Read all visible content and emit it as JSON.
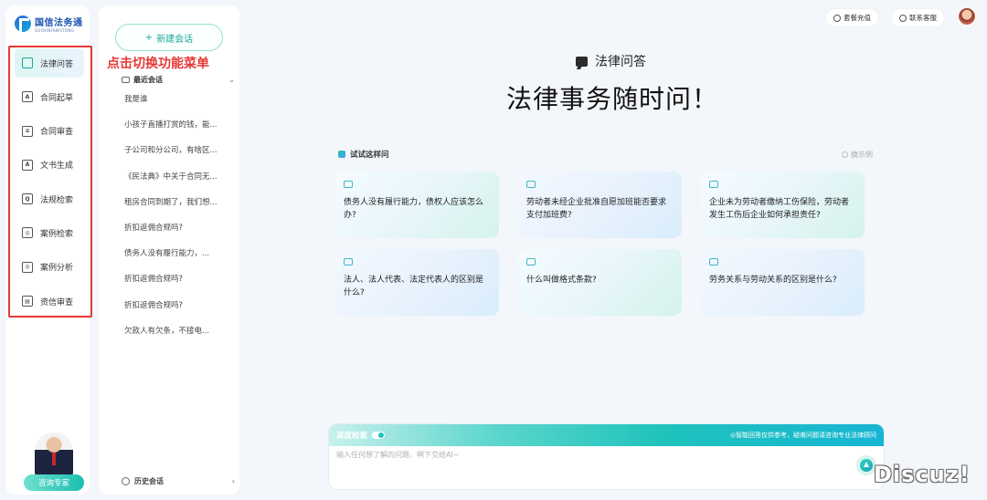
{
  "logo": {
    "name": "国信法务通",
    "sub": "GUOXINFAWUTONG"
  },
  "nav": {
    "items": [
      {
        "label": "法律问答",
        "icon": "chat-icon",
        "glyph": "",
        "active": true
      },
      {
        "label": "合同起草",
        "icon": "contract-draft-icon",
        "glyph": "A"
      },
      {
        "label": "合同审查",
        "icon": "contract-review-icon",
        "glyph": "≡"
      },
      {
        "label": "文书生成",
        "icon": "document-generate-icon",
        "glyph": "A"
      },
      {
        "label": "法规检索",
        "icon": "law-search-icon",
        "glyph": "Q"
      },
      {
        "label": "案例检索",
        "icon": "case-search-icon",
        "glyph": "◎"
      },
      {
        "label": "案例分析",
        "icon": "case-analysis-icon",
        "glyph": "◎"
      },
      {
        "label": "资信审查",
        "icon": "credit-review-icon",
        "glyph": "▤"
      }
    ],
    "consult_label": "咨询专家"
  },
  "annotation": "点击切换功能菜单",
  "sessions": {
    "new_chat_label": "新建会话",
    "recent_label": "最近会话",
    "items": [
      "我是谁",
      "小孩子直播打赏的钱，能...",
      "子公司和分公司，有啥区...",
      "《民法典》中关于合同无...",
      "租房合同到期了，我们想...",
      "折扣返佣合规吗?",
      "债务人没有履行能力，...",
      "折扣返佣合规吗?",
      "折扣返佣合规吗?",
      "欠款人有欠条，不接电..."
    ],
    "history_label": "历史会话"
  },
  "header": {
    "recharge_label": "套餐充值",
    "support_label": "联系客服"
  },
  "main": {
    "mode_title": "法律问答",
    "hero": "法律事务随时问！",
    "try_label": "试试这样问",
    "refresh_label": "换示例",
    "examples": [
      "债务人没有履行能力，债权人应该怎么办?",
      "劳动者未经企业批准自愿加班能否要求支付加班费?",
      "企业未为劳动者缴纳工伤保险，劳动者发生工伤后企业如何承担责任?",
      "法人、法人代表、法定代表人的区别是什么?",
      "什么叫做格式条款?",
      "劳务关系与劳动关系的区别是什么?"
    ]
  },
  "input": {
    "deep_search_label": "深度检索",
    "disclaimer": "◎智能回答仅供参考，疑难问题请咨询专业法律顾问",
    "placeholder": "输入任何想了解的问题，啊下交给AI~"
  },
  "watermark": "Discuz!"
}
